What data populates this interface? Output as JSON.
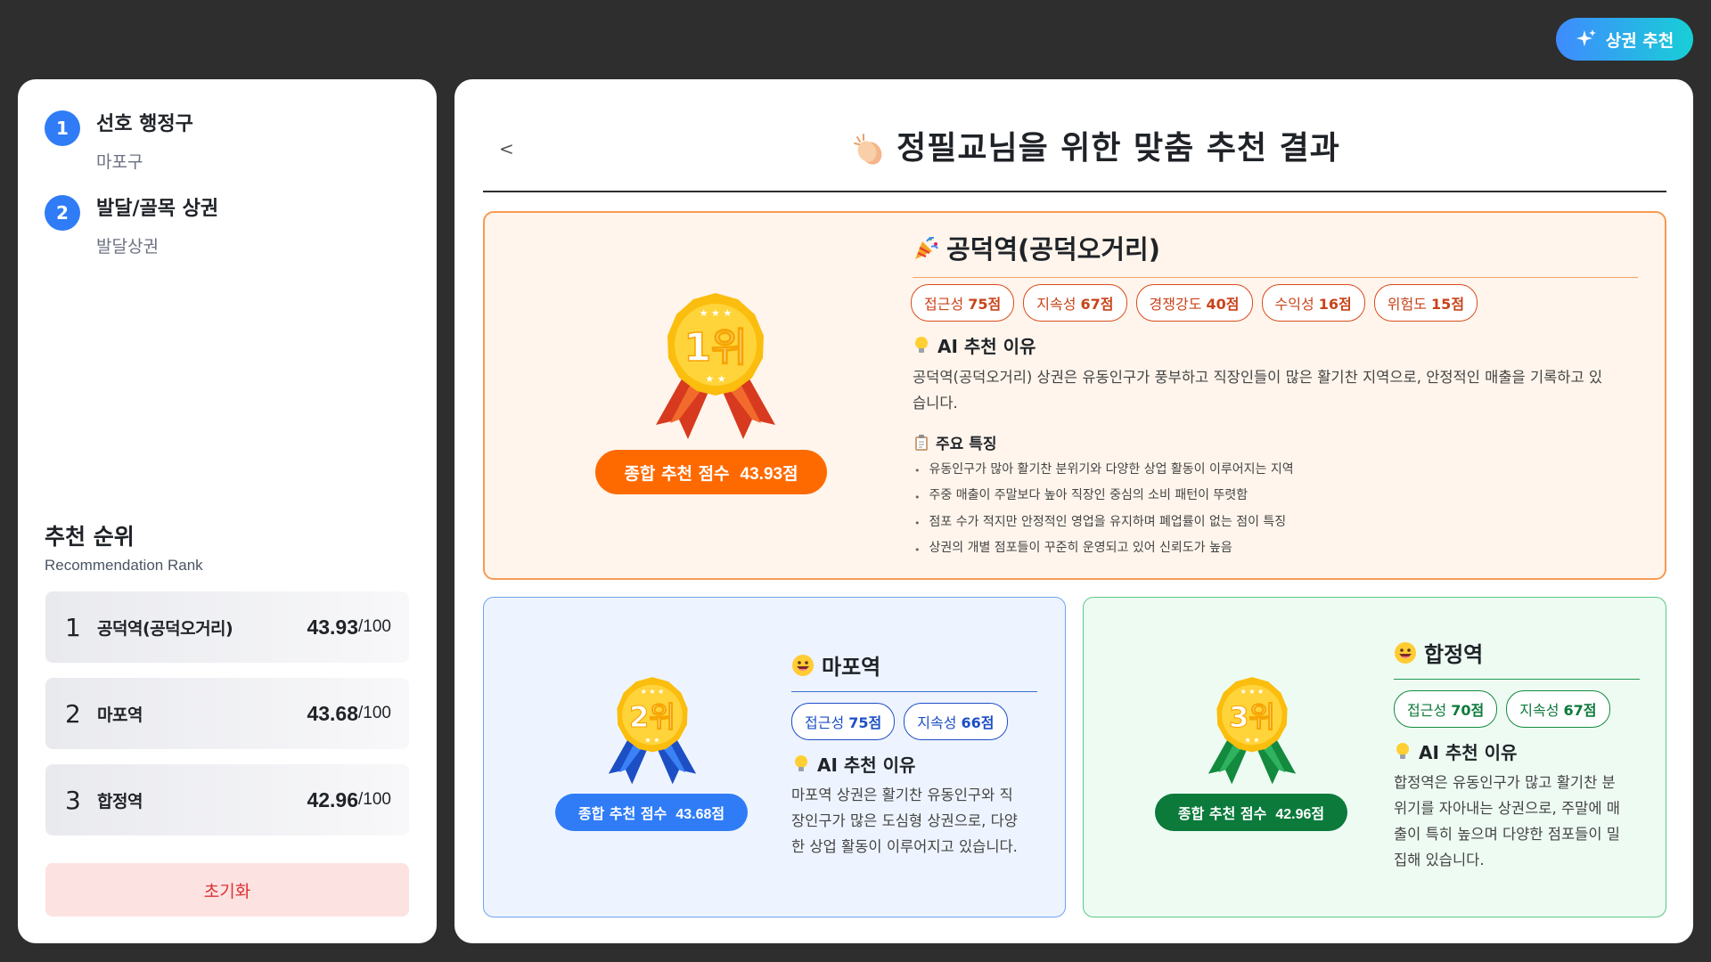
{
  "header_button": {
    "label": "상권 추천",
    "icon": "sparkle-icon"
  },
  "steps": [
    {
      "num": "1",
      "title": "선호 행정구",
      "value": "마포구"
    },
    {
      "num": "2",
      "title": "발달/골목 상권",
      "value": "발달상권"
    }
  ],
  "rank_section": {
    "title": "추천 순위",
    "subtitle": "Recommendation Rank",
    "items": [
      {
        "rank": "1",
        "name": "공덕역(공덕오거리)",
        "score": "43.93",
        "max": "/100"
      },
      {
        "rank": "2",
        "name": "마포역",
        "score": "43.68",
        "max": "/100"
      },
      {
        "rank": "3",
        "name": "합정역",
        "score": "42.96",
        "max": "/100"
      }
    ],
    "reset_label": "초기화"
  },
  "result": {
    "back_label": "<",
    "title": "정필교님을 위한 맞춤 추천 결과",
    "title_icon": "clapping-hands-icon",
    "cards": [
      {
        "medal_label": "1위",
        "score_label": "종합 추천 점수",
        "score": "43.93점",
        "icon": "party-popper-icon",
        "name": "공덕역(공덕오거리)",
        "tags": [
          {
            "label": "접근성",
            "value": "75점"
          },
          {
            "label": "지속성",
            "value": "67점"
          },
          {
            "label": "경쟁강도",
            "value": "40점"
          },
          {
            "label": "수익성",
            "value": "16점"
          },
          {
            "label": "위험도",
            "value": "15점"
          }
        ],
        "reason_title": "AI 추천 이유",
        "reason_line1": "공덕역(공덕오거리) 상권은 유동인구가 풍부하고 직장인들이 많은 활기찬 지역으로, 안정적인 매출을 기록하고 있",
        "reason_line2": "습니다.",
        "features_title": "주요 특징",
        "features": [
          "유동인구가 많아 활기찬 분위기와 다양한 상업 활동이 이루어지는 지역",
          "주중 매출이 주말보다 높아 직장인 중심의 소비 패턴이 뚜렷함",
          "점포 수가 적지만 안정적인 영업을 유지하며 폐업률이 없는 점이 특징",
          "상권의 개별 점포들이 꾸준히 운영되고 있어 신뢰도가 높음"
        ],
        "accent": "#ff6a00"
      },
      {
        "medal_label": "2위",
        "score_label": "종합 추천 점수",
        "score": "43.68점",
        "icon": "grinning-face-icon",
        "name": "마포역",
        "tags": [
          {
            "label": "접근성",
            "value": "75점"
          },
          {
            "label": "지속성",
            "value": "66점"
          }
        ],
        "reason_title": "AI 추천 이유",
        "reason_lines": [
          "마포역 상권은 활기찬 유동인구와 직",
          "장인구가 많은 도심형 상권으로, 다양",
          "한 상업 활동이 이루어지고 있습니다."
        ],
        "accent": "#2f7cf6"
      },
      {
        "medal_label": "3위",
        "score_label": "종합 추천 점수",
        "score": "42.96점",
        "icon": "grinning-face-icon",
        "name": "합정역",
        "tags": [
          {
            "label": "접근성",
            "value": "70점"
          },
          {
            "label": "지속성",
            "value": "67점"
          }
        ],
        "reason_title": "AI 추천 이유",
        "reason_lines": [
          "합정역은 유동인구가 많고 활기찬 분",
          "위기를 자아내는 상권으로, 주말에 매",
          "출이 특히 높으며 다양한 점포들이 밀",
          "집해 있습니다."
        ],
        "accent": "#0b7a3b"
      }
    ]
  }
}
